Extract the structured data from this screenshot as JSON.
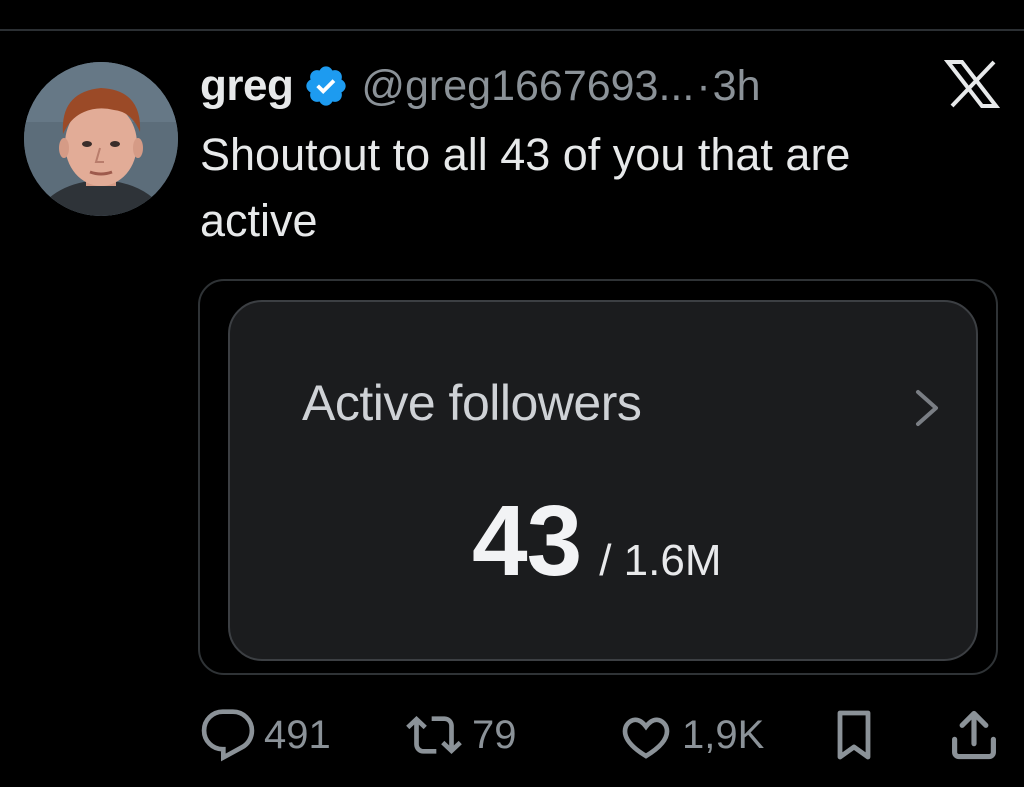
{
  "tweet": {
    "author": {
      "display_name": "greg",
      "handle": "@greg1667693...",
      "verified": true,
      "avatar_icon": "profile-photo"
    },
    "separator": "·",
    "time": "3h",
    "text": "Shoutout to all 43 of you that are active",
    "close_icon": "x-logo-icon"
  },
  "card": {
    "title": "Active followers",
    "value": "43",
    "total": "/ 1.6M",
    "chevron_icon": "chevron-right-icon"
  },
  "actions": {
    "replies": "491",
    "retweets": "79",
    "likes": "1,9K"
  },
  "colors": {
    "background": "#000000",
    "text_primary": "#e7e9ea",
    "text_secondary": "#8b9298",
    "verified_blue": "#1d9bf0",
    "card_bg": "#1b1c1e"
  }
}
